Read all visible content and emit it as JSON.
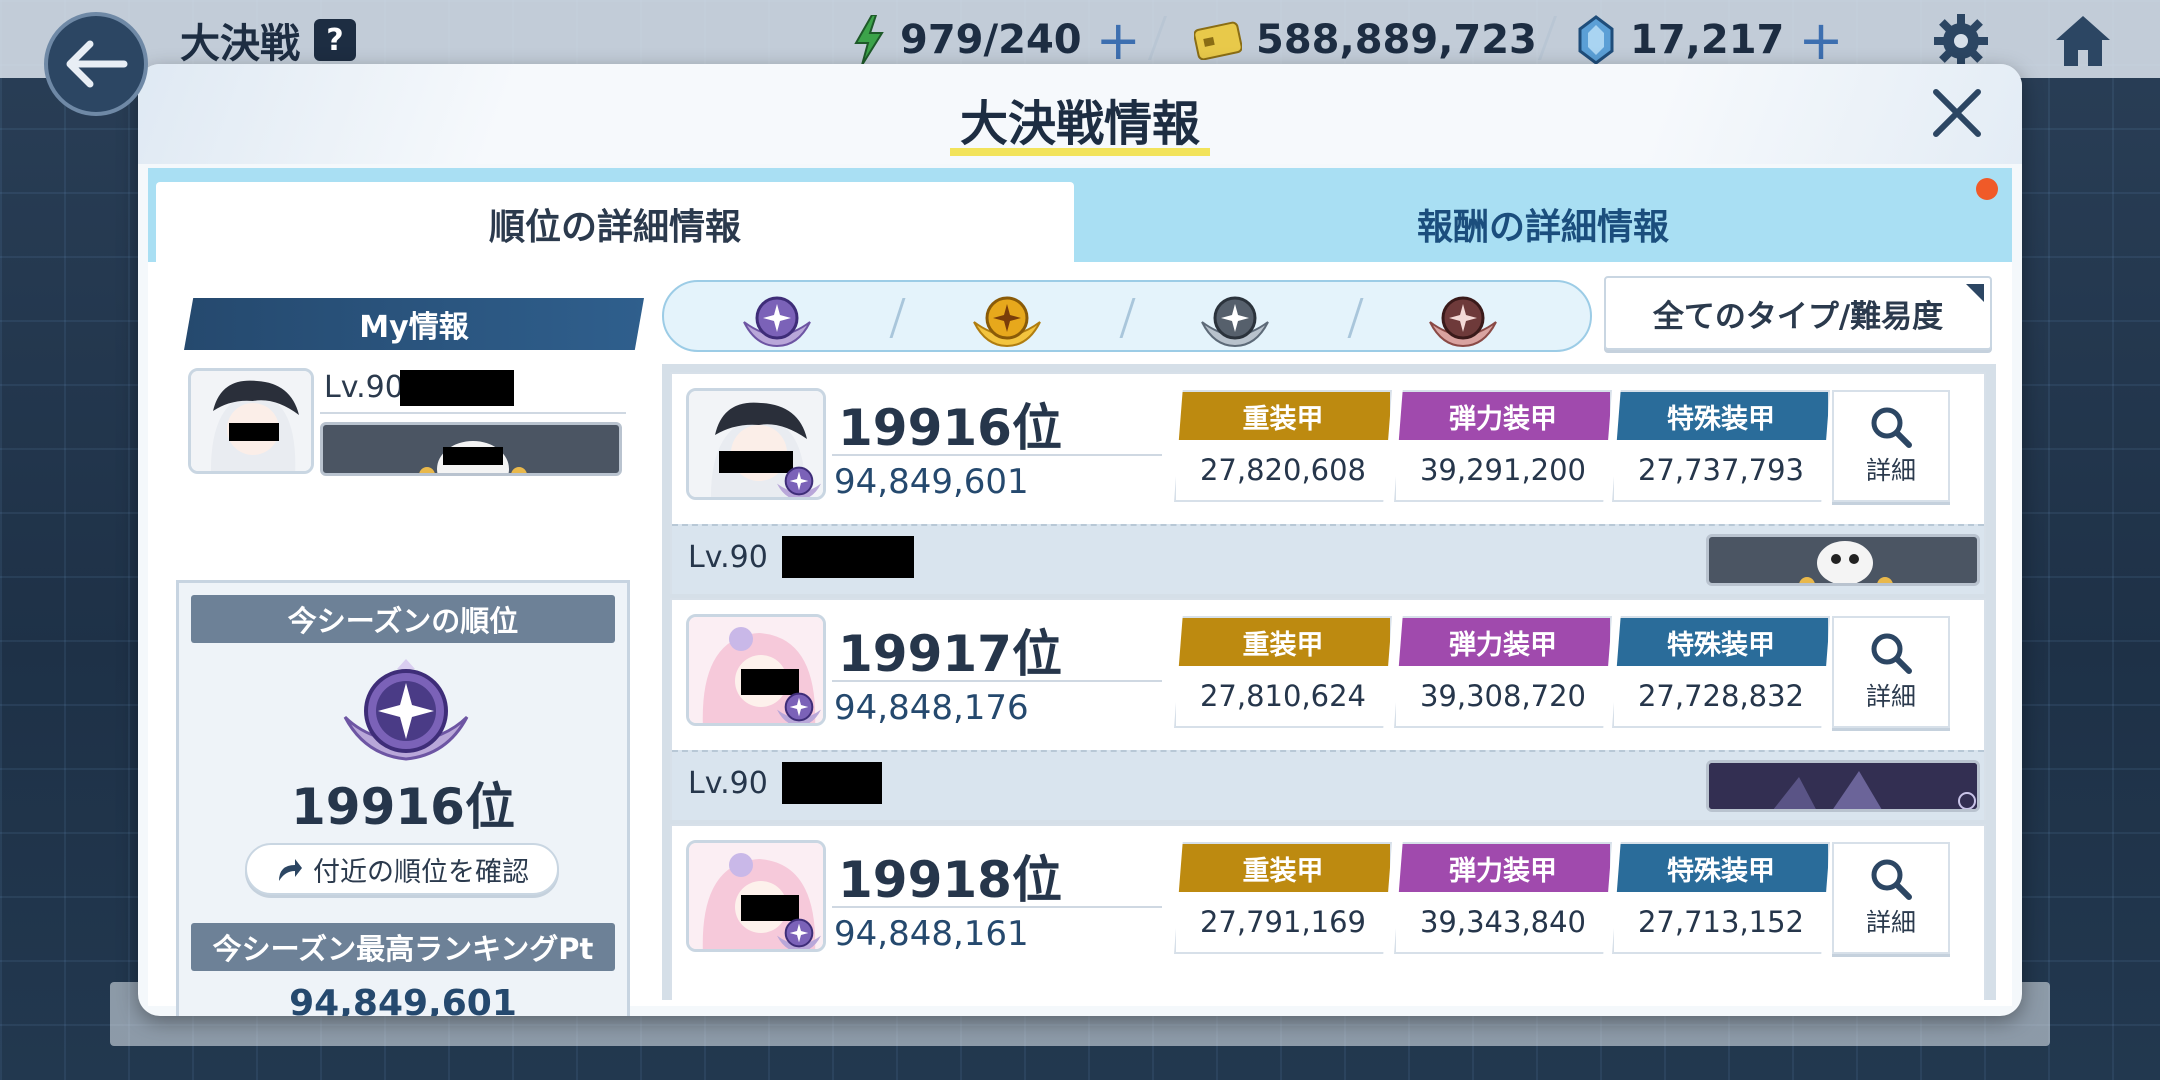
{
  "topbar": {
    "title": "大決戦",
    "help_label": "?",
    "stamina": "979/240",
    "credits": "588,889,723",
    "gems": "17,217",
    "plus": "+"
  },
  "dialog": {
    "title": "大決戦情報",
    "tabs": [
      {
        "label": "順位の詳細情報",
        "active": true
      },
      {
        "label": "報酬の詳細情報",
        "active": false
      }
    ]
  },
  "my_info": {
    "header": "My情報",
    "level": "Lv.90",
    "season_rank_header": "今シーズンの順位",
    "season_rank": "19916位",
    "nearby_button": "付近の順位を確認",
    "best_pt_header": "今シーズン最高ランキングPt",
    "best_pt": "94,849,601"
  },
  "filters": {
    "tiers": [
      "platinum-tier-icon",
      "gold-tier-icon",
      "silver-tier-icon",
      "bronze-tier-icon"
    ],
    "type_filter": "全てのタイプ/難易度"
  },
  "ranking": {
    "stat_labels": [
      "重装甲",
      "弾力装甲",
      "特殊装甲"
    ],
    "stat_colors": [
      "#bd8a10",
      "#a04aad",
      "#2a6c9a"
    ],
    "detail_label": "詳細",
    "rows": [
      {
        "rank": "19916位",
        "score": "94,849,601",
        "stats": [
          "27,820,608",
          "39,291,200",
          "27,737,793"
        ],
        "level": "Lv.90"
      },
      {
        "rank": "19917位",
        "score": "94,848,176",
        "stats": [
          "27,810,624",
          "39,308,720",
          "27,728,832"
        ],
        "level": "Lv.90"
      },
      {
        "rank": "19918位",
        "score": "94,848,161",
        "stats": [
          "27,791,169",
          "39,343,840",
          "27,713,152"
        ],
        "level": "Lv.90"
      }
    ]
  }
}
